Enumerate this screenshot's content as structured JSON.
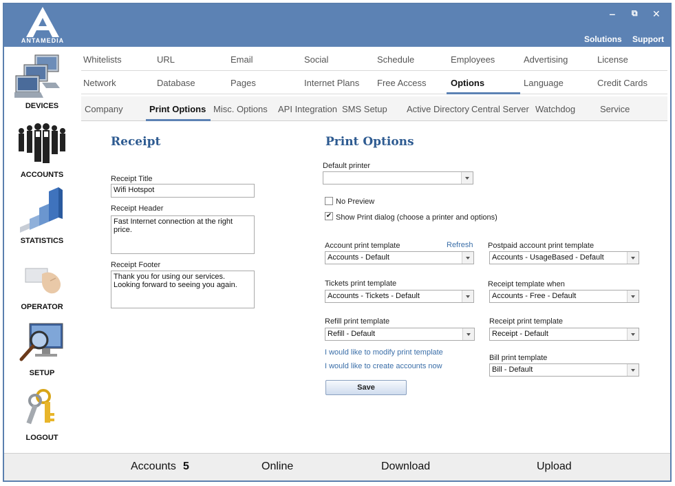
{
  "header": {
    "logo_text": "ANTAMEDIA",
    "minimize": "‒",
    "restore": "⧉",
    "close": "✕",
    "solutions": "Solutions",
    "support": "Support"
  },
  "sidebar": {
    "items": [
      {
        "label": "DEVICES",
        "icon": "devices-icon"
      },
      {
        "label": "ACCOUNTS",
        "icon": "accounts-icon"
      },
      {
        "label": "STATISTICS",
        "icon": "statistics-icon"
      },
      {
        "label": "OPERATOR",
        "icon": "operator-icon"
      },
      {
        "label": "SETUP",
        "icon": "setup-icon"
      },
      {
        "label": "LOGOUT",
        "icon": "logout-icon"
      }
    ]
  },
  "tabs_row1": [
    "Whitelists",
    "URL",
    "Email",
    "Social",
    "Schedule",
    "Employees",
    "Advertising",
    "License"
  ],
  "tabs_row2": [
    "Network",
    "Database",
    "Pages",
    "Internet Plans",
    "Free Access",
    "Options",
    "Language",
    "Credit Cards"
  ],
  "tabs_row2_active": "Options",
  "subtabs": [
    "Company",
    "Print Options",
    "Misc. Options",
    "API Integration",
    "SMS Setup",
    "Active Directory",
    "Central Server",
    "Watchdog",
    "Service"
  ],
  "subtabs_active": "Print Options",
  "receipt": {
    "title": "Receipt",
    "title_label": "Receipt Title",
    "title_value": "Wifi Hotspot",
    "header_label": "Receipt Header",
    "header_value": "Fast Internet connection at the right price.",
    "footer_label": "Receipt Footer",
    "footer_value": "Thank you for using our services. Looking forward to seeing you again."
  },
  "print_options": {
    "title": "Print Options",
    "default_printer_label": "Default printer",
    "default_printer_value": "",
    "no_preview_label": "No Preview",
    "no_preview_checked": false,
    "show_dialog_label": "Show Print dialog (choose a printer and options)",
    "show_dialog_checked": true,
    "refresh": "Refresh",
    "account_template_label": "Account print template",
    "account_template_value": "Accounts - Default",
    "tickets_template_label": "Tickets print template",
    "tickets_template_value": "Accounts - Tickets - Default",
    "refill_template_label": "Refill print template",
    "refill_template_value": "Refill - Default",
    "postpaid_template_label": "Postpaid account print template",
    "postpaid_template_value": "Accounts - UsageBased - Default",
    "receipt_when_label": "Receipt template when",
    "receipt_when_value": "Accounts - Free - Default",
    "receipt_template_label": "Receipt print template",
    "receipt_template_value": "Receipt - Default",
    "bill_template_label": "Bill print template",
    "bill_template_value": "Bill - Default",
    "modify_link": "I would like to modify print template",
    "create_link": "I would like to create accounts now",
    "save": "Save"
  },
  "bottom": {
    "accounts_label": "Accounts",
    "accounts_count": "5",
    "online": "Online",
    "download": "Download",
    "upload": "Upload"
  },
  "colors": {
    "header_bg": "#5c82b4",
    "section_title": "#2e5b91",
    "link": "#3a6ea8"
  }
}
